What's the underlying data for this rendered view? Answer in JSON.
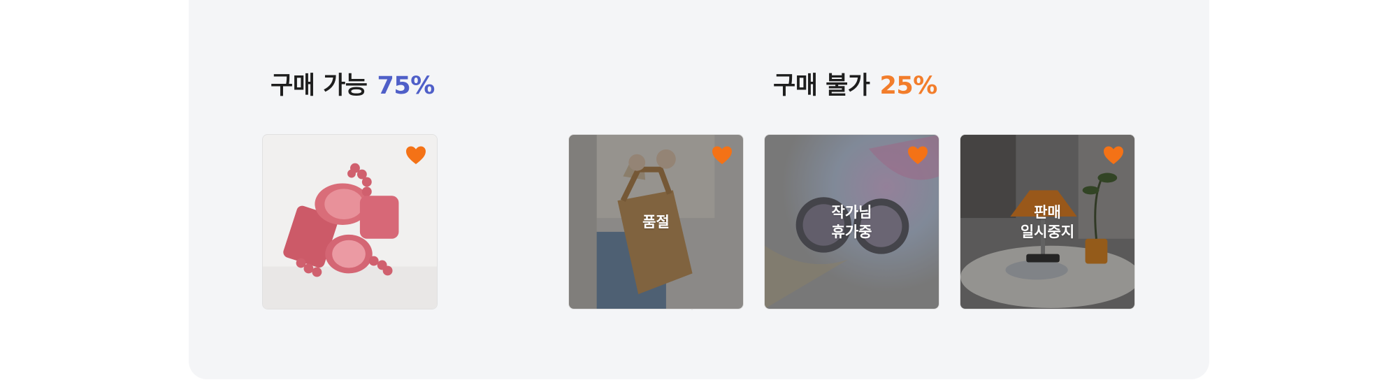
{
  "available": {
    "label": "구매 가능",
    "percent": "75%",
    "percent_color": "#4f5fc8"
  },
  "unavailable": {
    "label": "구매 불가",
    "percent": "25%",
    "percent_color": "#f27d2b"
  },
  "heart_color": "#f47216",
  "products": [
    {
      "kind": "mugs",
      "status": ""
    },
    {
      "kind": "bag",
      "status": "품절"
    },
    {
      "kind": "earrings",
      "status": "작가님\n휴가중"
    },
    {
      "kind": "lamp",
      "status": "판매\n일시중지"
    }
  ]
}
